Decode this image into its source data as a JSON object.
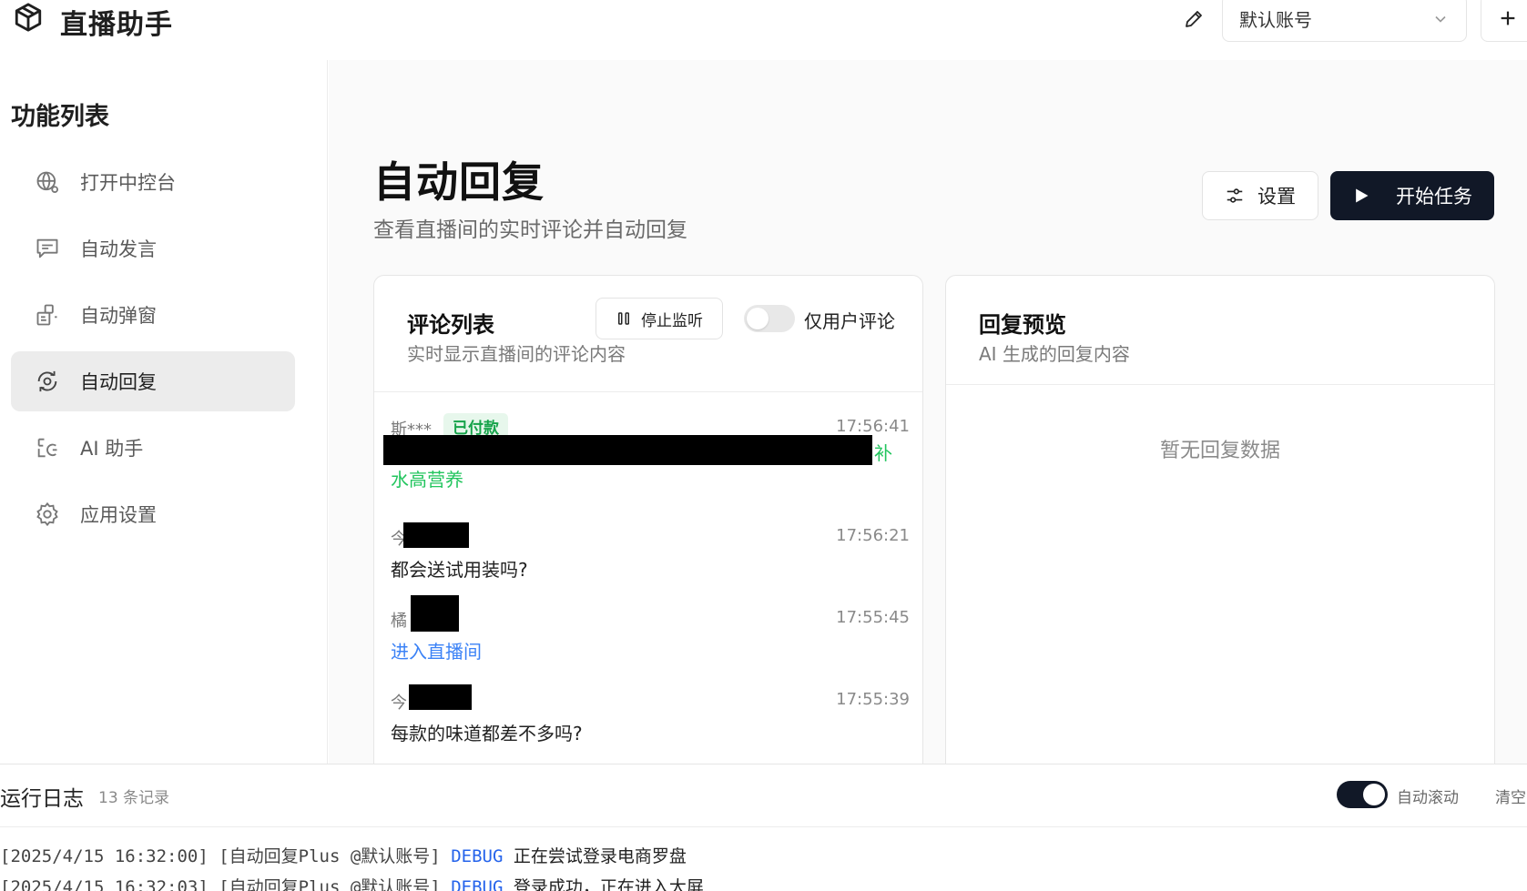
{
  "header": {
    "app_title": "直播助手",
    "account": "默认账号"
  },
  "sidebar": {
    "title": "功能列表",
    "items": [
      {
        "label": "打开中控台",
        "icon": "globe-icon"
      },
      {
        "label": "自动发言",
        "icon": "message-icon"
      },
      {
        "label": "自动弹窗",
        "icon": "popup-icon"
      },
      {
        "label": "自动回复",
        "icon": "auto-reply-icon",
        "active": true
      },
      {
        "label": "AI 助手",
        "icon": "ai-assistant-icon"
      },
      {
        "label": "应用设置",
        "icon": "gear-icon"
      }
    ]
  },
  "main": {
    "title": "自动回复",
    "subtitle": "查看直播间的实时评论并自动回复",
    "settings_label": "设置",
    "start_label": "开始任务"
  },
  "comments": {
    "title": "评论列表",
    "subtitle": "实时显示直播间的评论内容",
    "stop_label": "停止监听",
    "user_only_label": "仅用户评论",
    "user_only_on": false,
    "items": [
      {
        "user": "斯***",
        "badge": "已付款",
        "time": "17:56:41",
        "text_suffix": "补",
        "text_line2": "水高营养"
      },
      {
        "user": "今",
        "time": "17:56:21",
        "text": "都会送试用装吗?"
      },
      {
        "user": "橘",
        "time": "17:55:45",
        "text": "进入直播间"
      },
      {
        "user": "今",
        "time": "17:55:39",
        "text": "每款的味道都差不多吗?"
      }
    ]
  },
  "preview": {
    "title": "回复预览",
    "subtitle": "AI 生成的回复内容",
    "empty": "暂无回复数据"
  },
  "log": {
    "title": "运行日志",
    "count": "13 条记录",
    "auto_scroll_label": "自动滚动",
    "auto_scroll_on": true,
    "clear_label": "清空",
    "lines": [
      {
        "prefix": "[2025/4/15 16:32:00] [自动回复Plus @默认账号]",
        "level": "DEBUG",
        "message": "正在尝试登录电商罗盘"
      },
      {
        "prefix": "[2025/4/15 16:32:03] [自动回复Plus @默认账号]",
        "level": "DEBUG",
        "message": "登录成功，正在进入大屏"
      }
    ]
  },
  "colors": {
    "primary": "#111827",
    "success": "#16a34a",
    "link": "#3b82f6",
    "debug": "#2563eb"
  }
}
